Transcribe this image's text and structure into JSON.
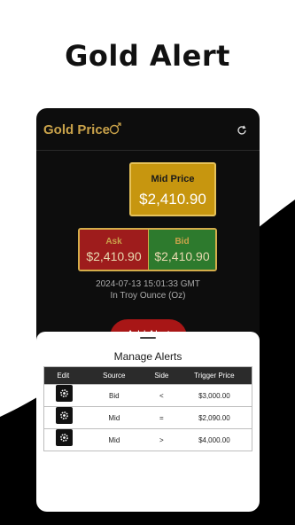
{
  "headline": "Gold Alert",
  "app": {
    "title": "Gold Price",
    "title_icon": "gold-coin-icon",
    "refresh_icon": "refresh-icon"
  },
  "mid": {
    "label": "Mid Price",
    "value": "$2,410.90"
  },
  "ask": {
    "label": "Ask",
    "value": "$2,410.90"
  },
  "bid": {
    "label": "Bid",
    "value": "$2,410.90"
  },
  "timestamp": "2024-07-13 15:01:33 GMT",
  "unit": "In Troy Ounce (Oz)",
  "add_button": "Add Alert",
  "sheet": {
    "title": "Manage Alerts",
    "columns": [
      "Edit",
      "Source",
      "Side",
      "Trigger Price"
    ],
    "rows": [
      {
        "source": "Bid",
        "side": "<",
        "trigger": "$3,000.00"
      },
      {
        "source": "Mid",
        "side": "=",
        "trigger": "$2,090.00"
      },
      {
        "source": "Mid",
        "side": ">",
        "trigger": "$4,000.00"
      }
    ]
  },
  "colors": {
    "gold": "#c9a24a",
    "mid_card": "#c7960f",
    "ask": "#9e1c1c",
    "bid": "#2d7a2d",
    "add_button": "#a81616"
  }
}
